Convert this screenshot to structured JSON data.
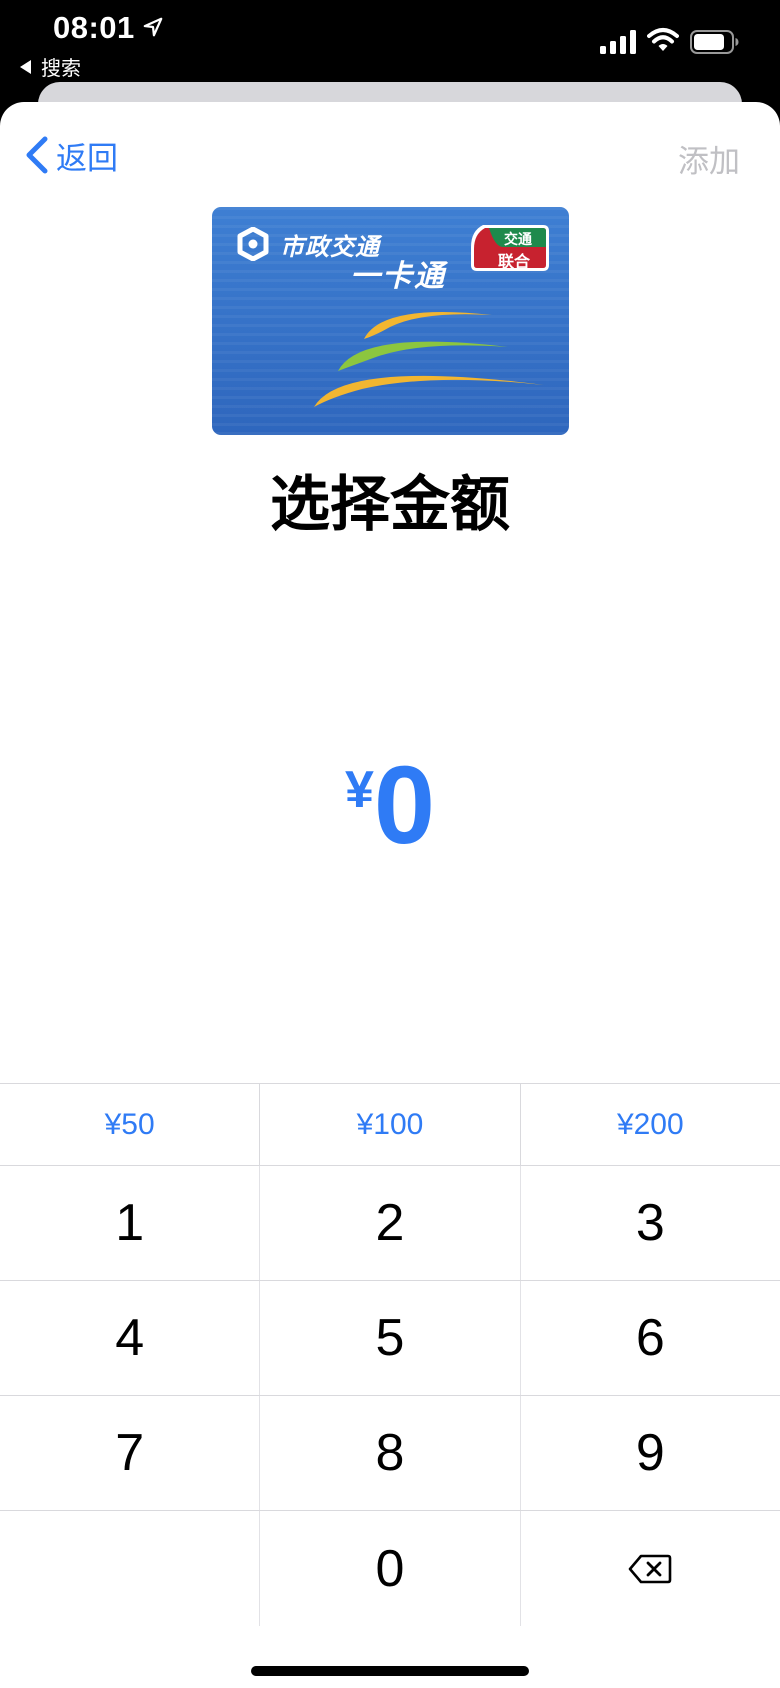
{
  "status_bar": {
    "time": "08:01",
    "back_app_label": "搜索"
  },
  "nav": {
    "back_label": "返回",
    "add_label": "添加"
  },
  "card": {
    "brand_top": "市政交通",
    "brand_bottom": "一卡通",
    "badge_top": "交通",
    "badge_bottom": "联合",
    "colors": {
      "card_blue": "#3e7fd3",
      "arc_yellow": "#f2b631",
      "arc_green": "#8cc63f",
      "badge_red": "#c7222f",
      "badge_green": "#1e8a4c"
    }
  },
  "page": {
    "title": "选择金额",
    "currency_symbol": "¥",
    "amount": "0"
  },
  "keypad": {
    "presets": [
      "¥50",
      "¥100",
      "¥200"
    ],
    "rows": [
      [
        "1",
        "2",
        "3"
      ],
      [
        "4",
        "5",
        "6"
      ],
      [
        "7",
        "8",
        "9"
      ]
    ],
    "zero": "0"
  },
  "theme": {
    "accent": "#2f7bf5",
    "disabled": "#c0c0c4"
  }
}
